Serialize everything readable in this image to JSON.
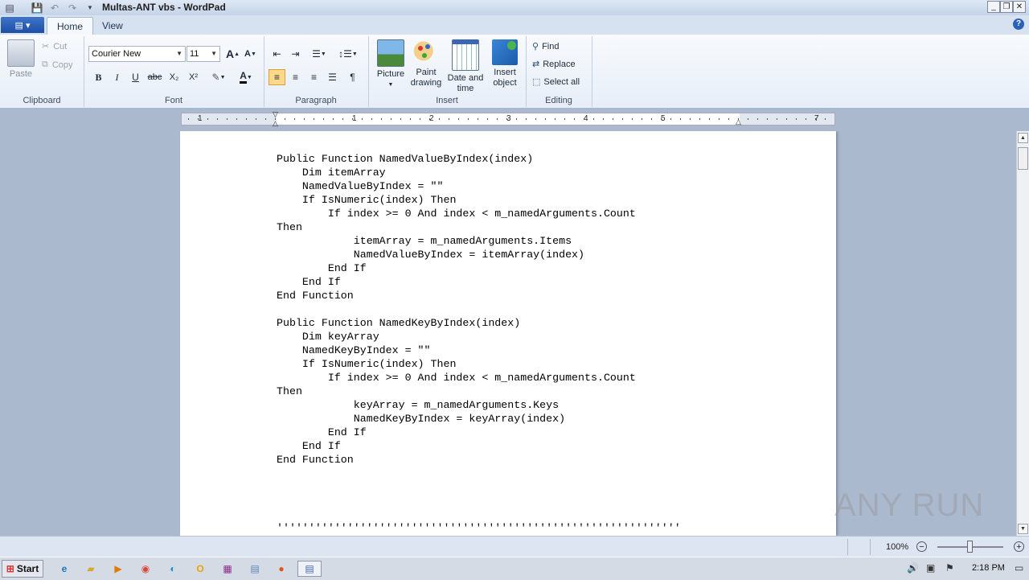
{
  "window": {
    "title": "Multas-ANT vbs - WordPad",
    "controls": {
      "minimize": "_",
      "restore": "❐",
      "close": "✕"
    }
  },
  "tabs": [
    {
      "label": "Home",
      "active": true
    },
    {
      "label": "View",
      "active": false
    }
  ],
  "help": "?",
  "ribbon": {
    "clipboard": {
      "label": "Clipboard",
      "paste": "Paste",
      "cut": "Cut",
      "copy": "Copy"
    },
    "font": {
      "label": "Font",
      "family": "Courier New",
      "size": "11",
      "bold": "B",
      "italic": "I",
      "underline": "U",
      "strike": "abc",
      "sub": "X₂",
      "sup": "X²",
      "grow": "A",
      "shrink": "A",
      "color_letter": "A"
    },
    "paragraph": {
      "label": "Paragraph"
    },
    "insert": {
      "label": "Insert",
      "picture": "Picture",
      "paint": [
        "Paint",
        "drawing"
      ],
      "datetime": [
        "Date and",
        "time"
      ],
      "object": [
        "Insert",
        "object"
      ]
    },
    "editing": {
      "label": "Editing",
      "find": "Find",
      "replace": "Replace",
      "select_all": "Select all"
    }
  },
  "ruler": {
    "numbers": [
      "1",
      "1",
      "2",
      "3",
      "4",
      "5",
      "7"
    ]
  },
  "document": {
    "text": "Public Function NamedValueByIndex(index)\n    Dim itemArray\n    NamedValueByIndex = \"\"\n    If IsNumeric(index) Then\n        If index >= 0 And index < m_namedArguments.Count\nThen\n            itemArray = m_namedArguments.Items\n            NamedValueByIndex = itemArray(index)\n        End If\n    End If\nEnd Function\n\nPublic Function NamedKeyByIndex(index)\n    Dim keyArray\n    NamedKeyByIndex = \"\"\n    If IsNumeric(index) Then\n        If index >= 0 And index < m_namedArguments.Count\nThen\n            keyArray = m_namedArguments.Keys\n            NamedKeyByIndex = keyArray(index)\n        End If\n    End If\nEnd Function\n\n\n\n\n'''''''''''''''''''''''''''''''''''''''''''''''''''''''''''''''"
  },
  "status": {
    "zoom": "100%",
    "zoom_out": "−",
    "zoom_in": "+"
  },
  "watermark": "ANY RUN",
  "taskbar": {
    "start": "Start",
    "clock": "2:18 PM"
  },
  "colors": {
    "accent": "#1d4fa5",
    "selected_button": "#ffd98a",
    "workspace": "#abb9cf"
  }
}
